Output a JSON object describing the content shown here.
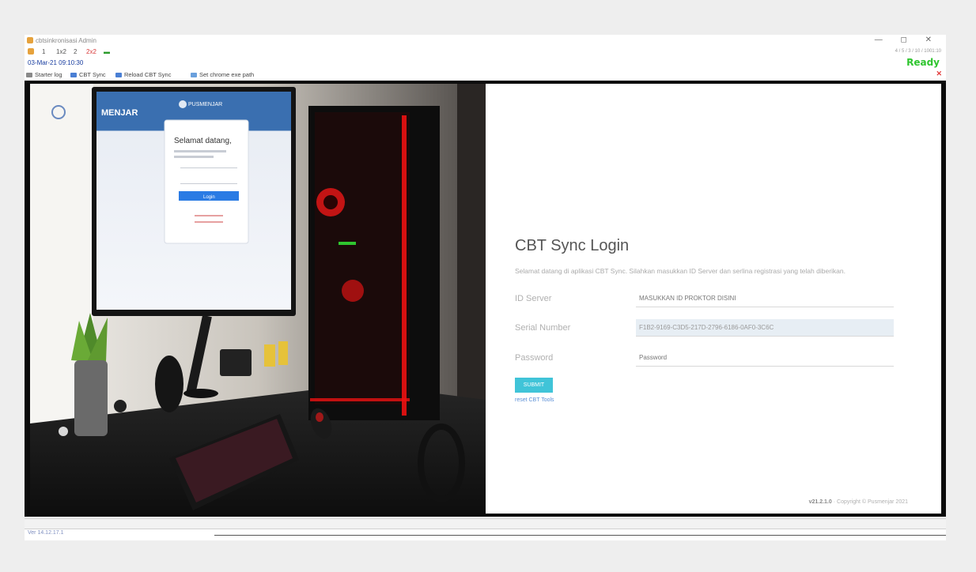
{
  "window": {
    "title": "cbtsinkronisasi Admin",
    "controls": "—  ◻  ✕",
    "right_info": "4 / 5 / 3 / 10 / 1001:10"
  },
  "toolbar": {
    "buttons": [
      "1",
      "1x2",
      "2",
      "2x2",
      "▬"
    ]
  },
  "info": {
    "datetime": "03-Mar-21 09:10:30",
    "status": "Ready"
  },
  "menu": {
    "items": [
      "Starter log",
      "CBT Sync",
      "Reload CBT Sync",
      "Set chrome exe path"
    ]
  },
  "colors": {
    "accent": "#40c4d8",
    "ready": "#2fc52f",
    "frame": "#0b0b0b"
  },
  "photo": {
    "screen_brand": "MENJAR",
    "header_brand": "PUSMENJAR",
    "card_title": "Selamat datang,",
    "card_button": "Login"
  },
  "login": {
    "title": "CBT Sync Login",
    "subtitle": "Selamat datang di aplikasi CBT Sync. Silahkan masukkan ID Server dan serlina registrasi yang telah diberikan.",
    "id_server_label": "ID Server",
    "id_server_value": "MASUKKAN ID PROKTOR DISINI",
    "serial_label": "Serial Number",
    "serial_value": "F1B2-9169-C3D5-217D-2796-6186-0AF0-3C6C",
    "password_label": "Password",
    "password_placeholder": "Password",
    "submit_label": "SUBMIT",
    "reset_link": "reset CBT Tools",
    "version": "v21.2.1.0",
    "copyright": "· Copyright © Pusmenjar 2021"
  },
  "statusbar": {
    "text": "Ver 14.12.17.1"
  }
}
